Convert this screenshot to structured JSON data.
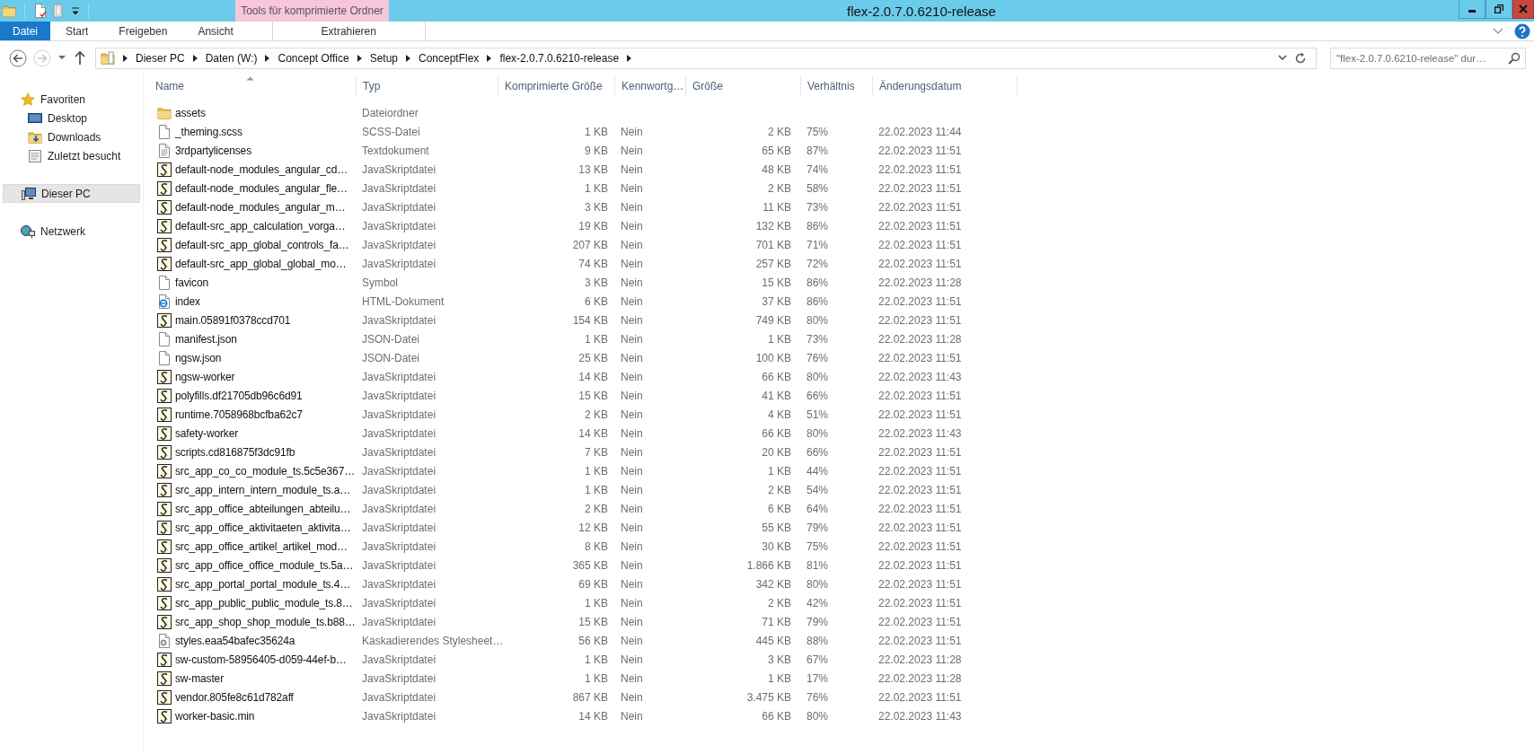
{
  "window": {
    "title": "flex-2.0.7.0.6210-release",
    "context_tab": "Tools für komprimierte Ordner"
  },
  "ribbon_tabs": [
    {
      "label": "Datei",
      "kind": "file",
      "selected": false
    },
    {
      "label": "Start",
      "kind": "normal",
      "selected": false
    },
    {
      "label": "Freigeben",
      "kind": "normal",
      "selected": false
    },
    {
      "label": "Ansicht",
      "kind": "normal",
      "selected": false
    },
    {
      "label": "Extrahieren",
      "kind": "context",
      "selected": false
    }
  ],
  "navigation": [
    {
      "kind": "back",
      "disabled": false
    },
    {
      "kind": "forward",
      "disabled": true
    },
    {
      "kind": "recent",
      "disabled": false
    },
    {
      "kind": "up",
      "disabled": false
    }
  ],
  "address_bar": {
    "crumbs": [
      "Dieser PC",
      "Daten (W:)",
      "Concept Office",
      "Setup",
      "ConceptFlex",
      "flex-2.0.7.0.6210-release"
    ]
  },
  "search": {
    "placeholder": "\"flex-2.0.7.0.6210-release\" dur…"
  },
  "sidebar": {
    "items": [
      {
        "label": "Favoriten",
        "kind": "favorites",
        "selected": false,
        "children": [
          {
            "label": "Desktop",
            "kind": "desktop",
            "selected": false
          },
          {
            "label": "Downloads",
            "kind": "downloads",
            "selected": false
          },
          {
            "label": "Zuletzt besucht",
            "kind": "recent",
            "selected": false
          }
        ]
      },
      {
        "label": "Dieser PC",
        "kind": "pc",
        "selected": true
      },
      {
        "label": "Netzwerk",
        "kind": "network",
        "selected": false
      }
    ]
  },
  "table": {
    "columns": [
      {
        "label": "Name",
        "sorted": true
      },
      {
        "label": "Typ",
        "sorted": false
      },
      {
        "label": "Komprimierte Größe",
        "sorted": false
      },
      {
        "label": "Kennwortg…",
        "sorted": false
      },
      {
        "label": "Größe",
        "sorted": false
      },
      {
        "label": "Verhältnis",
        "sorted": false
      },
      {
        "label": "Änderungsdatum",
        "sorted": false
      }
    ],
    "rows": [
      {
        "kind": "folder",
        "name": "assets",
        "type": "Dateiordner"
      },
      {
        "kind": "file",
        "name": "_theming.scss",
        "type": "SCSS-Datei",
        "compressed": "1 KB",
        "password": "Nein",
        "size": "2 KB",
        "ratio": "75%",
        "date": "22.02.2023 11:44"
      },
      {
        "kind": "text",
        "name": "3rdpartylicenses",
        "type": "Textdokument",
        "compressed": "9 KB",
        "password": "Nein",
        "size": "65 KB",
        "ratio": "87%",
        "date": "22.02.2023 11:51"
      },
      {
        "kind": "script",
        "name": "default-node_modules_angular_cd…",
        "type": "JavaSkriptdatei",
        "compressed": "13 KB",
        "password": "Nein",
        "size": "48 KB",
        "ratio": "74%",
        "date": "22.02.2023 11:51"
      },
      {
        "kind": "script",
        "name": "default-node_modules_angular_fle…",
        "type": "JavaSkriptdatei",
        "compressed": "1 KB",
        "password": "Nein",
        "size": "2 KB",
        "ratio": "58%",
        "date": "22.02.2023 11:51"
      },
      {
        "kind": "script",
        "name": "default-node_modules_angular_m…",
        "type": "JavaSkriptdatei",
        "compressed": "3 KB",
        "password": "Nein",
        "size": "11 KB",
        "ratio": "73%",
        "date": "22.02.2023 11:51"
      },
      {
        "kind": "script",
        "name": "default-src_app_calculation_vorga…",
        "type": "JavaSkriptdatei",
        "compressed": "19 KB",
        "password": "Nein",
        "size": "132 KB",
        "ratio": "86%",
        "date": "22.02.2023 11:51"
      },
      {
        "kind": "script",
        "name": "default-src_app_global_controls_fa…",
        "type": "JavaSkriptdatei",
        "compressed": "207 KB",
        "password": "Nein",
        "size": "701 KB",
        "ratio": "71%",
        "date": "22.02.2023 11:51"
      },
      {
        "kind": "script",
        "name": "default-src_app_global_global_mo…",
        "type": "JavaSkriptdatei",
        "compressed": "74 KB",
        "password": "Nein",
        "size": "257 KB",
        "ratio": "72%",
        "date": "22.02.2023 11:51"
      },
      {
        "kind": "file",
        "name": "favicon",
        "type": "Symbol",
        "compressed": "3 KB",
        "password": "Nein",
        "size": "15 KB",
        "ratio": "86%",
        "date": "22.02.2023 11:28"
      },
      {
        "kind": "html",
        "name": "index",
        "type": "HTML-Dokument",
        "compressed": "6 KB",
        "password": "Nein",
        "size": "37 KB",
        "ratio": "86%",
        "date": "22.02.2023 11:51"
      },
      {
        "kind": "script",
        "name": "main.05891f0378ccd701",
        "type": "JavaSkriptdatei",
        "compressed": "154 KB",
        "password": "Nein",
        "size": "749 KB",
        "ratio": "80%",
        "date": "22.02.2023 11:51"
      },
      {
        "kind": "file",
        "name": "manifest.json",
        "type": "JSON-Datei",
        "compressed": "1 KB",
        "password": "Nein",
        "size": "1 KB",
        "ratio": "73%",
        "date": "22.02.2023 11:28"
      },
      {
        "kind": "file",
        "name": "ngsw.json",
        "type": "JSON-Datei",
        "compressed": "25 KB",
        "password": "Nein",
        "size": "100 KB",
        "ratio": "76%",
        "date": "22.02.2023 11:51"
      },
      {
        "kind": "script",
        "name": "ngsw-worker",
        "type": "JavaSkriptdatei",
        "compressed": "14 KB",
        "password": "Nein",
        "size": "66 KB",
        "ratio": "80%",
        "date": "22.02.2023 11:43"
      },
      {
        "kind": "script",
        "name": "polyfills.df21705db96c6d91",
        "type": "JavaSkriptdatei",
        "compressed": "15 KB",
        "password": "Nein",
        "size": "41 KB",
        "ratio": "66%",
        "date": "22.02.2023 11:51"
      },
      {
        "kind": "script",
        "name": "runtime.7058968bcfba62c7",
        "type": "JavaSkriptdatei",
        "compressed": "2 KB",
        "password": "Nein",
        "size": "4 KB",
        "ratio": "51%",
        "date": "22.02.2023 11:51"
      },
      {
        "kind": "script",
        "name": "safety-worker",
        "type": "JavaSkriptdatei",
        "compressed": "14 KB",
        "password": "Nein",
        "size": "66 KB",
        "ratio": "80%",
        "date": "22.02.2023 11:43"
      },
      {
        "kind": "script",
        "name": "scripts.cd816875f3dc91fb",
        "type": "JavaSkriptdatei",
        "compressed": "7 KB",
        "password": "Nein",
        "size": "20 KB",
        "ratio": "66%",
        "date": "22.02.2023 11:51"
      },
      {
        "kind": "script",
        "name": "src_app_co_co_module_ts.5c5e367…",
        "type": "JavaSkriptdatei",
        "compressed": "1 KB",
        "password": "Nein",
        "size": "1 KB",
        "ratio": "44%",
        "date": "22.02.2023 11:51"
      },
      {
        "kind": "script",
        "name": "src_app_intern_intern_module_ts.a…",
        "type": "JavaSkriptdatei",
        "compressed": "1 KB",
        "password": "Nein",
        "size": "2 KB",
        "ratio": "54%",
        "date": "22.02.2023 11:51"
      },
      {
        "kind": "script",
        "name": "src_app_office_abteilungen_abteilu…",
        "type": "JavaSkriptdatei",
        "compressed": "2 KB",
        "password": "Nein",
        "size": "6 KB",
        "ratio": "64%",
        "date": "22.02.2023 11:51"
      },
      {
        "kind": "script",
        "name": "src_app_office_aktivitaeten_aktivita…",
        "type": "JavaSkriptdatei",
        "compressed": "12 KB",
        "password": "Nein",
        "size": "55 KB",
        "ratio": "79%",
        "date": "22.02.2023 11:51"
      },
      {
        "kind": "script",
        "name": "src_app_office_artikel_artikel_mod…",
        "type": "JavaSkriptdatei",
        "compressed": "8 KB",
        "password": "Nein",
        "size": "30 KB",
        "ratio": "75%",
        "date": "22.02.2023 11:51"
      },
      {
        "kind": "script",
        "name": "src_app_office_office_module_ts.5a…",
        "type": "JavaSkriptdatei",
        "compressed": "365 KB",
        "password": "Nein",
        "size": "1.866 KB",
        "ratio": "81%",
        "date": "22.02.2023 11:51"
      },
      {
        "kind": "script",
        "name": "src_app_portal_portal_module_ts.4…",
        "type": "JavaSkriptdatei",
        "compressed": "69 KB",
        "password": "Nein",
        "size": "342 KB",
        "ratio": "80%",
        "date": "22.02.2023 11:51"
      },
      {
        "kind": "script",
        "name": "src_app_public_public_module_ts.8…",
        "type": "JavaSkriptdatei",
        "compressed": "1 KB",
        "password": "Nein",
        "size": "2 KB",
        "ratio": "42%",
        "date": "22.02.2023 11:51"
      },
      {
        "kind": "script",
        "name": "src_app_shop_shop_module_ts.b88…",
        "type": "JavaSkriptdatei",
        "compressed": "15 KB",
        "password": "Nein",
        "size": "71 KB",
        "ratio": "79%",
        "date": "22.02.2023 11:51"
      },
      {
        "kind": "css",
        "name": "styles.eaa54bafec35624a",
        "type": "Kaskadierendes Stylesheet…",
        "compressed": "56 KB",
        "password": "Nein",
        "size": "445 KB",
        "ratio": "88%",
        "date": "22.02.2023 11:51"
      },
      {
        "kind": "script",
        "name": "sw-custom-58956405-d059-44ef-b…",
        "type": "JavaSkriptdatei",
        "compressed": "1 KB",
        "password": "Nein",
        "size": "3 KB",
        "ratio": "67%",
        "date": "22.02.2023 11:28"
      },
      {
        "kind": "script",
        "name": "sw-master",
        "type": "JavaSkriptdatei",
        "compressed": "1 KB",
        "password": "Nein",
        "size": "1 KB",
        "ratio": "17%",
        "date": "22.02.2023 11:28"
      },
      {
        "kind": "script",
        "name": "vendor.805fe8c61d782aff",
        "type": "JavaSkriptdatei",
        "compressed": "867 KB",
        "password": "Nein",
        "size": "3.475 KB",
        "ratio": "76%",
        "date": "22.02.2023 11:51"
      },
      {
        "kind": "script",
        "name": "worker-basic.min",
        "type": "JavaSkriptdatei",
        "compressed": "14 KB",
        "password": "Nein",
        "size": "66 KB",
        "ratio": "80%",
        "date": "22.02.2023 11:43"
      }
    ]
  }
}
